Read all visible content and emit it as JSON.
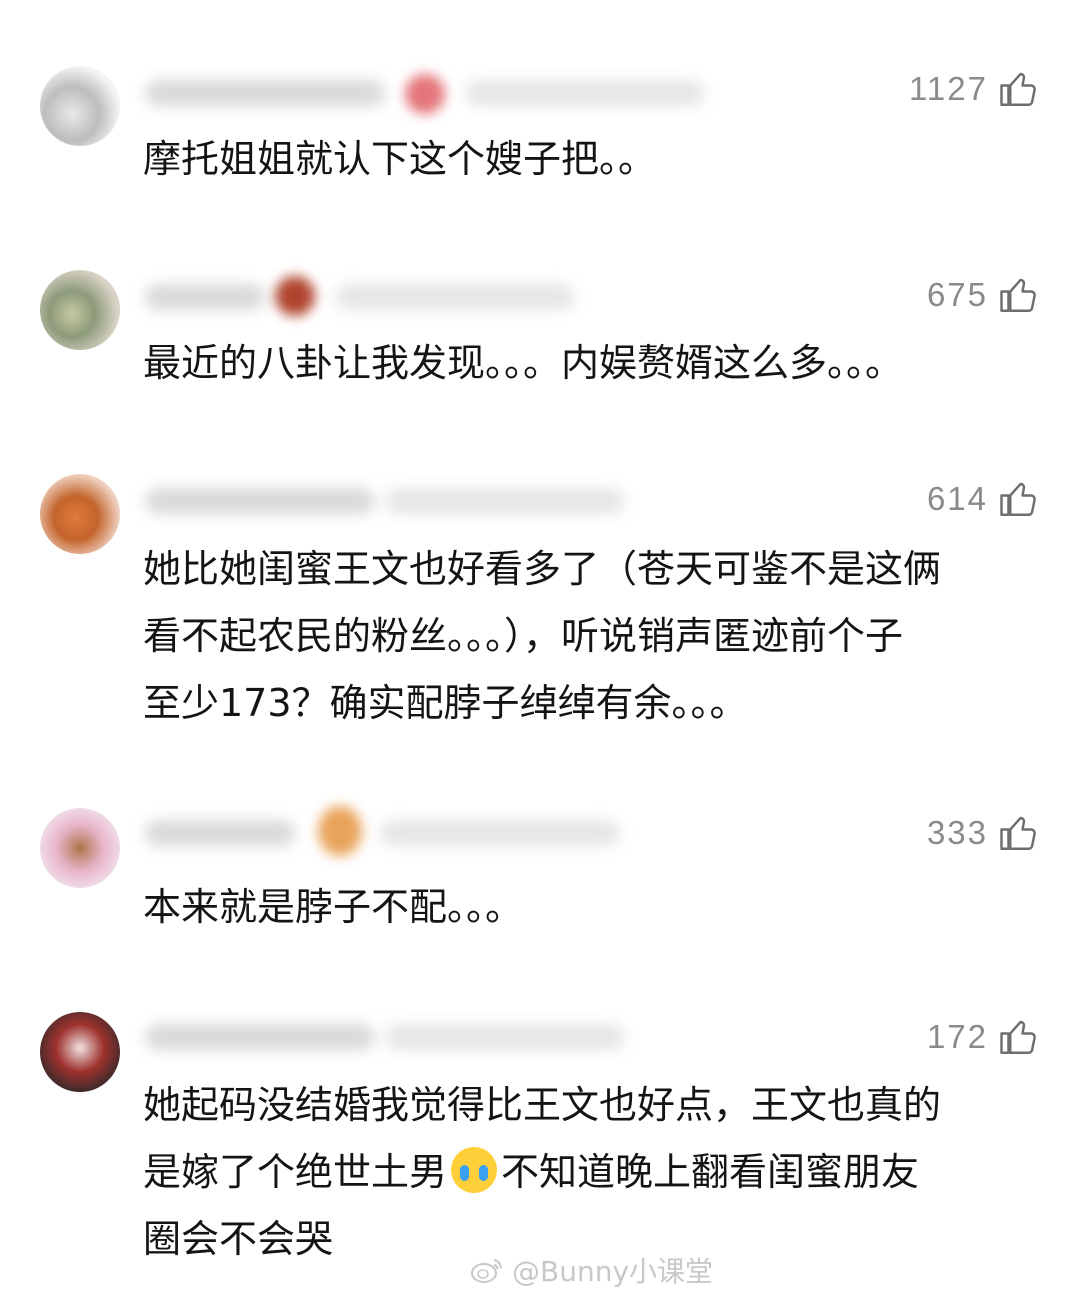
{
  "comments": [
    {
      "likes": "1127",
      "lines": [
        "摩托姐姐就认下这个嫂子把。。"
      ]
    },
    {
      "likes": "675",
      "lines": [
        "最近的八卦让我发现。。。内娱赘婿这么多。。。"
      ]
    },
    {
      "likes": "614",
      "lines": [
        "她比她闺蜜王文也好看多了（苍天可鉴不是这俩",
        "看不起农民的粉丝。。。），听说销声匿迹前个子",
        "至少173？确实配脖子绰绰有余。。。"
      ]
    },
    {
      "likes": "333",
      "lines": [
        "本来就是脖子不配。。。"
      ]
    },
    {
      "likes": "172",
      "lines": [
        "她起码没结婚我觉得比王文也好点，王文也真的",
        "是嫁了个绝世土男",
        "不知道晚上翻看闺蜜朋友",
        "圈会不会哭"
      ]
    }
  ],
  "icons": {
    "like": "thumbs-up-icon",
    "emoji": "crying-face-icon",
    "watermark": "weibo-icon"
  },
  "watermark": "@Bunny小课堂",
  "colors": {
    "like_gray": "#8a8a8a",
    "text": "#141414",
    "bg": "#ffffff"
  }
}
